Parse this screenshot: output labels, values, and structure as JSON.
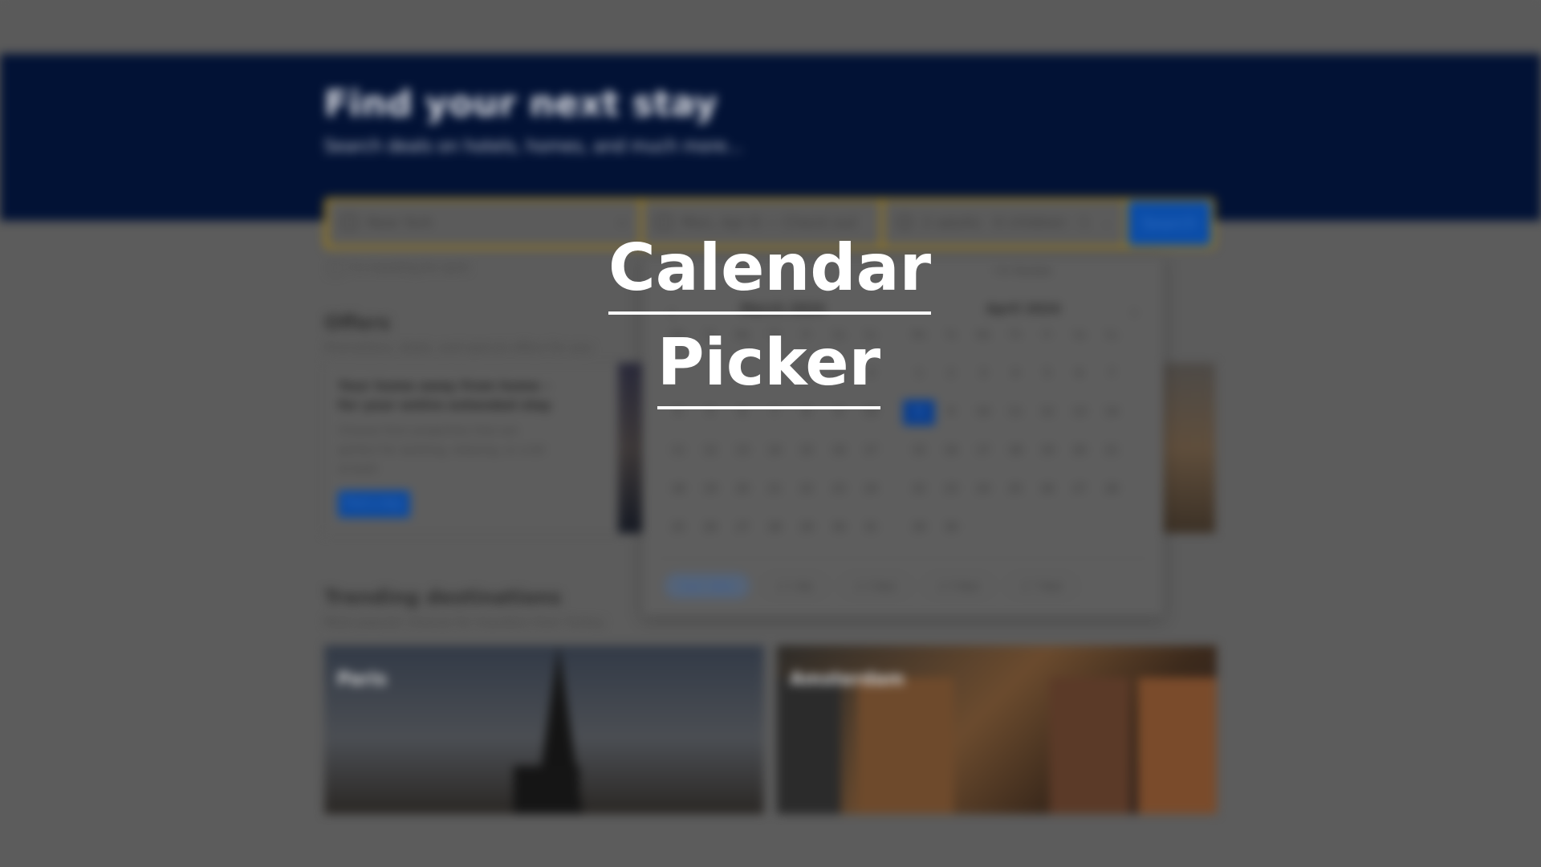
{
  "overlay": {
    "title_line1": "Calendar",
    "title_line2": "Picker"
  },
  "colors": {
    "hero_bg": "#021235",
    "accent_blue": "#0b4da8",
    "search_outline": "#9a7a1a",
    "scrim": "#5c5c5c"
  },
  "hero": {
    "title": "Find your next stay",
    "subtitle": "Search deals on hotels, homes, and much more..."
  },
  "search": {
    "destination_icon": "bed-icon",
    "destination_value": "New York",
    "dates_icon": "calendar-icon",
    "dates_value": "Mon, Apr 8 — Check-out date",
    "guests_icon": "person-icon",
    "guests_value": "2 adults · 0 children · 1 room",
    "button_label": "Search",
    "work_trip_label": "I'm traveling for work"
  },
  "offers": {
    "title": "Offers",
    "subtitle": "Promotions, deals, and special offers for you",
    "card_title": "Your home away from home – for your entire extended stay",
    "card_desc": "Choose from properties that are perfect for working, relaxing, or a bit of both",
    "card_button": "Find a stay"
  },
  "calendar": {
    "top_tab_label": "I'm flexible",
    "prev_icon": "chevron-left-icon",
    "next_icon": "chevron-right-icon",
    "months": [
      {
        "title": "March 2024",
        "weekdays": [
          "Mo",
          "Tu",
          "We",
          "Th",
          "Fr",
          "Sa",
          "Su"
        ],
        "weeks": [
          [
            "",
            "",
            "",
            "",
            "1",
            "2",
            "3"
          ],
          [
            "4",
            "5",
            "6",
            "7",
            "8",
            "9",
            "10"
          ],
          [
            "11",
            "12",
            "13",
            "14",
            "15",
            "16",
            "17"
          ],
          [
            "18",
            "19",
            "20",
            "21",
            "22",
            "23",
            "24"
          ],
          [
            "25",
            "26",
            "27",
            "28",
            "29",
            "30",
            "31"
          ]
        ]
      },
      {
        "title": "April 2024",
        "weekdays": [
          "Mo",
          "Tu",
          "We",
          "Th",
          "Fr",
          "Sa",
          "Su"
        ],
        "weeks": [
          [
            "1",
            "2",
            "3",
            "4",
            "5",
            "6",
            "7"
          ],
          [
            "8",
            "9",
            "10",
            "11",
            "12",
            "13",
            "14"
          ],
          [
            "15",
            "16",
            "17",
            "18",
            "19",
            "20",
            "21"
          ],
          [
            "22",
            "23",
            "24",
            "25",
            "26",
            "27",
            "28"
          ],
          [
            "29",
            "30",
            "",
            "",
            "",
            "",
            ""
          ]
        ],
        "selected_day": "8"
      }
    ],
    "flex_options": [
      "Exact dates",
      "± 1 day",
      "± 2 days",
      "± 3 days",
      "± 7 days"
    ]
  },
  "trending": {
    "title": "Trending destinations",
    "subtitle": "Most popular choices for travelers from Turkey",
    "destinations": [
      {
        "name": "Paris"
      },
      {
        "name": "Amsterdam"
      }
    ]
  }
}
